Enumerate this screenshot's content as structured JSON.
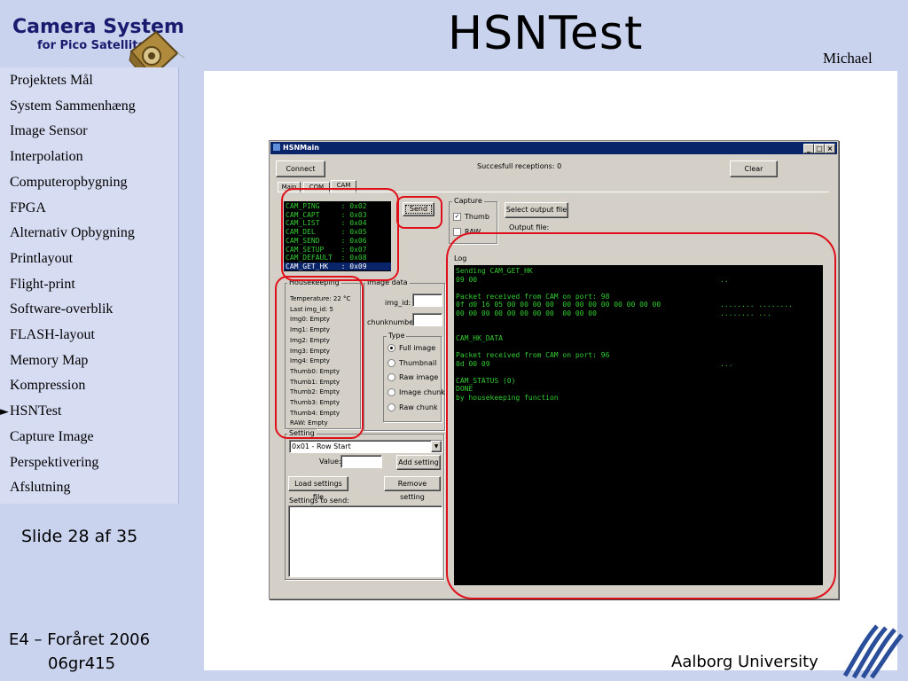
{
  "slide": {
    "logo_title": "Camera System",
    "logo_subtitle": "for Pico Satellites",
    "title": "HSNTest",
    "author": "Michael",
    "nav_marker": "►",
    "nav_items": [
      "Projektets Mål",
      "System Sammenhæng",
      "Image Sensor",
      "Interpolation",
      "Computeropbygning",
      "FPGA",
      "Alternativ Opbygning",
      "Printlayout",
      "Flight-print",
      "Software-overblik",
      "FLASH-layout",
      "Memory Map",
      "Kompression",
      "HSNTest",
      "Capture Image",
      "Perspektivering",
      "Afslutning"
    ],
    "current_item": "HSNTest",
    "slide_counter": "Slide 28 af 35",
    "course": "E4 – Foråret 2006",
    "group": "06gr415",
    "university": "Aalborg University",
    "annotation_color": "#e0101a"
  },
  "window": {
    "title": "HSNMain",
    "connect_label": "Connect",
    "receptions": "Succesfull receptions: 0",
    "clear_label": "Clear",
    "tabs": [
      "Main",
      "COM",
      "CAM"
    ],
    "active_tab": "CAM",
    "commands": [
      {
        "name": "CAM_PING",
        "code": "0x02"
      },
      {
        "name": "CAM_CAPT",
        "code": "0x03"
      },
      {
        "name": "CAM_LIST",
        "code": "0x04"
      },
      {
        "name": "CAM_DEL",
        "code": "0x05"
      },
      {
        "name": "CAM_SEND",
        "code": "0x06"
      },
      {
        "name": "CAM_SETUP",
        "code": "0x07"
      },
      {
        "name": "CAM_DEFAULT",
        "code": "0x08"
      },
      {
        "name": "CAM_GET_HK",
        "code": "0x09"
      }
    ],
    "selected_command": "CAM_GET_HK",
    "send_label": "Send",
    "capture_title": "Capture",
    "thumb_label": "Thumb",
    "thumb_checked": true,
    "raw_label": "RAW",
    "raw_checked": false,
    "select_output_label": "Select output file",
    "output_file_label": "Output file:",
    "log_title": "Log",
    "housekeeping_title": "Housekeeping",
    "housekeeping": [
      "Temperature: 22 °C",
      "Last img_id: 5",
      "Img0: Empty",
      "Img1: Empty",
      "Img2: Empty",
      "Img3: Empty",
      "Img4: Empty",
      "Thumb0: Empty",
      "Thumb1: Empty",
      "Thumb2: Empty",
      "Thumb3: Empty",
      "Thumb4: Empty",
      "RAW: Empty"
    ],
    "image_data_title": "Image data",
    "img_id_label": "img_id:",
    "chunknumber_label": "chunknumber:",
    "type_title": "Type",
    "types": [
      "Full image",
      "Thumbnail",
      "Raw image",
      "Image chunk",
      "Raw chunk"
    ],
    "selected_type": "Full image",
    "setting_title": "Setting",
    "setting_selected": "0x01 - Row Start",
    "value_label": "Value:",
    "add_setting_label": "Add setting",
    "load_settings_label": "Load settings file",
    "remove_setting_label": "Remove setting",
    "settings_to_send_label": "Settings to send:",
    "log_lines": [
      {
        "left": "Sending CAM_GET_HK",
        "right": ""
      },
      {
        "left": "09 00",
        "right": ".."
      },
      {
        "left": "",
        "right": ""
      },
      {
        "left": "Packet received from CAM on port: 98",
        "right": ""
      },
      {
        "left": "0f d0 16 05 00 00 00 00  00 00 00 00 00 00 00 00",
        "right": "........ ........"
      },
      {
        "left": "00 00 00 00 00 00 00 00  00 00 00",
        "right": "........ ..."
      },
      {
        "left": "",
        "right": ""
      },
      {
        "left": "",
        "right": ""
      },
      {
        "left": "CAM_HK_DATA",
        "right": ""
      },
      {
        "left": "",
        "right": ""
      },
      {
        "left": "Packet received from CAM on port: 96",
        "right": ""
      },
      {
        "left": "0d 00 09",
        "right": "..."
      },
      {
        "left": "",
        "right": ""
      },
      {
        "left": "CAM_STATUS (0)",
        "right": ""
      },
      {
        "left": "DONE",
        "right": ""
      },
      {
        "left": "by housekeeping function",
        "right": ""
      }
    ]
  }
}
